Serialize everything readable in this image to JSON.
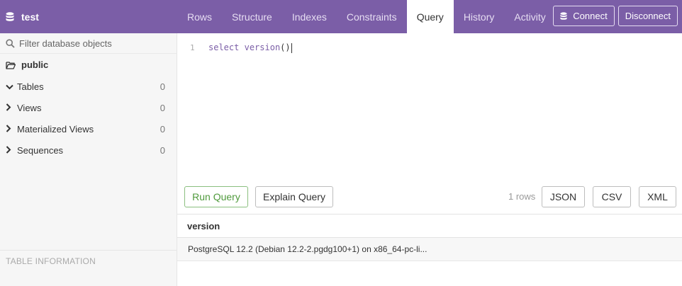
{
  "app": {
    "db_name": "test"
  },
  "tabs": [
    {
      "label": "Rows"
    },
    {
      "label": "Structure"
    },
    {
      "label": "Indexes"
    },
    {
      "label": "Constraints"
    },
    {
      "label": "Query"
    },
    {
      "label": "History"
    },
    {
      "label": "Activity"
    }
  ],
  "active_tab": "Query",
  "actions": {
    "connect_label": "Connect",
    "disconnect_label": "Disconnect"
  },
  "sidebar": {
    "filter_placeholder": "Filter database objects",
    "schema": "public",
    "objects": [
      {
        "label": "Tables",
        "count": "0",
        "expanded": true
      },
      {
        "label": "Views",
        "count": "0",
        "expanded": false
      },
      {
        "label": "Materialized Views",
        "count": "0",
        "expanded": false
      },
      {
        "label": "Sequences",
        "count": "0",
        "expanded": false
      }
    ],
    "table_info_label": "TABLE INFORMATION"
  },
  "editor": {
    "line_number": "1",
    "keyword_select": "select",
    "function_name": "version",
    "parens": "()"
  },
  "toolbar": {
    "run_label": "Run Query",
    "explain_label": "Explain Query",
    "rows_count": "1 rows",
    "json_label": "JSON",
    "csv_label": "CSV",
    "xml_label": "XML"
  },
  "results": {
    "columns": [
      "version"
    ],
    "rows": [
      [
        "PostgreSQL 12.2 (Debian 12.2-2.pgdg100+1) on x86_64-pc-li..."
      ]
    ]
  },
  "colors": {
    "brand": "#7b5ea7",
    "run_green": "#4f9a3c"
  }
}
